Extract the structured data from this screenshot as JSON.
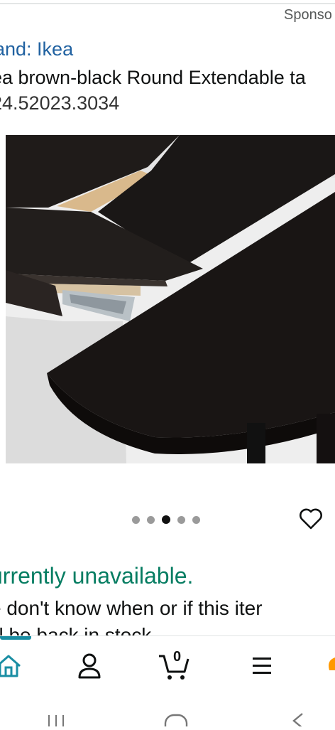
{
  "header": {
    "sponsored": "Sponso",
    "brand": "and: Ikea",
    "title": "ea brown-black Round Extendable ta",
    "subtitle": "24.52023.3034"
  },
  "image": {
    "description_icon": "table-photo",
    "carousel_total": 5,
    "carousel_active": 3
  },
  "availability": {
    "status": "urrently unavailable.",
    "note": "e don't know when or if this iter",
    "note2": "ill be back in stock"
  },
  "colors": {
    "brand_link": "#2162a1",
    "status_green": "#067d62",
    "accent_teal": "#1a8ea3",
    "accent_orange": "#ff9900"
  },
  "nav": {
    "cart_count": "0",
    "items": [
      "home-icon",
      "account-icon",
      "cart-icon",
      "menu-icon",
      "rufus-icon"
    ]
  },
  "system_nav": [
    "recents-icon",
    "home-circle-icon",
    "back-icon"
  ]
}
